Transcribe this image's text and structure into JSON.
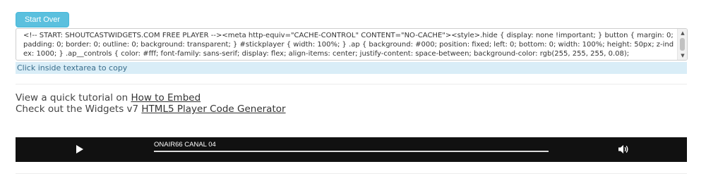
{
  "toolbar": {
    "start_over_label": "Start Over"
  },
  "embed_code": {
    "text": "<!-- START: SHOUTCASTWIDGETS.COM FREE PLAYER --><meta http-equiv=\"CACHE-CONTROL\" CONTENT=\"NO-CACHE\"><style>.hide { display: none !important; } button { margin: 0; padding: 0; border: 0; outline: 0; background: transparent; } #stickplayer { width: 100%; } .ap { background: #000; position: fixed; left: 0; bottom: 0; width: 100%; height: 50px; z-index: 1000; } .ap__controls { color: #fff; font-family: sans-serif; display: flex; align-items: center; justify-content: space-between; background-color: rgb(255, 255, 255, 0.08);",
    "copy_hint": "Click inside textarea to copy"
  },
  "links": {
    "tutorial_prefix": "View a quick tutorial on ",
    "tutorial_link": "How to Embed",
    "generator_prefix": "Check out the Widgets v7 ",
    "generator_link": "HTML5 Player Code Generator"
  },
  "player": {
    "station_name": "ONAIR66 CANAL 04",
    "progress": 1.0,
    "play_icon": "play-icon",
    "volume_icon": "volume-icon",
    "colors": {
      "background": "#111111",
      "progress_track": "#555555",
      "progress_fill": "#dddddd"
    }
  },
  "colors": {
    "button": "#5bc0de",
    "hint_background": "#d9edf7"
  }
}
